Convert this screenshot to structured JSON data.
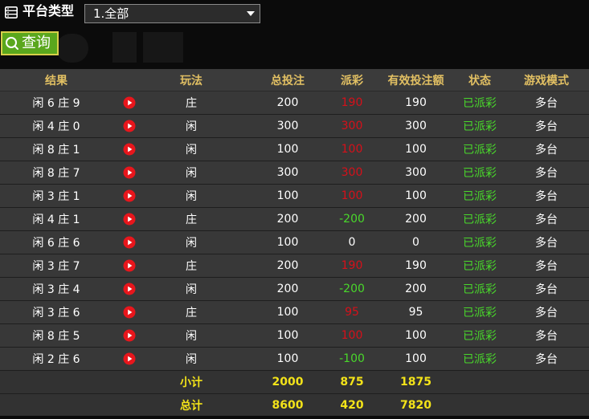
{
  "header": {
    "platform_label": "平台类型",
    "select_value": "1.全部",
    "query_label": "查询"
  },
  "table": {
    "columns": [
      "结果",
      "玩法",
      "总投注",
      "派彩",
      "有效投注额",
      "状态",
      "游戏模式"
    ],
    "rows": [
      {
        "result": "闲 6 庄 9",
        "method": "庄",
        "bet": "200",
        "payout": "190",
        "payout_color": "#d6101a",
        "valid": "190",
        "status": "已派彩",
        "mode": "多台"
      },
      {
        "result": "闲 4 庄 0",
        "method": "闲",
        "bet": "300",
        "payout": "300",
        "payout_color": "#d6101a",
        "valid": "300",
        "status": "已派彩",
        "mode": "多台"
      },
      {
        "result": "闲 8 庄 1",
        "method": "闲",
        "bet": "100",
        "payout": "100",
        "payout_color": "#d6101a",
        "valid": "100",
        "status": "已派彩",
        "mode": "多台"
      },
      {
        "result": "闲 8 庄 7",
        "method": "闲",
        "bet": "300",
        "payout": "300",
        "payout_color": "#d6101a",
        "valid": "300",
        "status": "已派彩",
        "mode": "多台"
      },
      {
        "result": "闲 3 庄 1",
        "method": "闲",
        "bet": "100",
        "payout": "100",
        "payout_color": "#d6101a",
        "valid": "100",
        "status": "已派彩",
        "mode": "多台"
      },
      {
        "result": "闲 4 庄 1",
        "method": "庄",
        "bet": "200",
        "payout": "-200",
        "payout_color": "#49d82b",
        "valid": "200",
        "status": "已派彩",
        "mode": "多台"
      },
      {
        "result": "闲 6 庄 6",
        "method": "闲",
        "bet": "100",
        "payout": "0",
        "payout_color": "#ffffff",
        "valid": "0",
        "status": "已派彩",
        "mode": "多台"
      },
      {
        "result": "闲 3 庄 7",
        "method": "庄",
        "bet": "200",
        "payout": "190",
        "payout_color": "#d6101a",
        "valid": "190",
        "status": "已派彩",
        "mode": "多台"
      },
      {
        "result": "闲 3 庄 4",
        "method": "闲",
        "bet": "200",
        "payout": "-200",
        "payout_color": "#49d82b",
        "valid": "200",
        "status": "已派彩",
        "mode": "多台"
      },
      {
        "result": "闲 3 庄 6",
        "method": "庄",
        "bet": "100",
        "payout": "95",
        "payout_color": "#d6101a",
        "valid": "95",
        "status": "已派彩",
        "mode": "多台"
      },
      {
        "result": "闲 8 庄 5",
        "method": "闲",
        "bet": "100",
        "payout": "100",
        "payout_color": "#d6101a",
        "valid": "100",
        "status": "已派彩",
        "mode": "多台"
      },
      {
        "result": "闲 2 庄 6",
        "method": "闲",
        "bet": "100",
        "payout": "-100",
        "payout_color": "#49d82b",
        "valid": "100",
        "status": "已派彩",
        "mode": "多台"
      }
    ],
    "subtotal": {
      "label": "小计",
      "bet": "2000",
      "payout": "875",
      "valid": "1875"
    },
    "total": {
      "label": "总计",
      "bet": "8600",
      "payout": "420",
      "valid": "7820"
    }
  },
  "colors": {
    "header_text": "#e2c063",
    "win_red": "#d6101a",
    "loss_green": "#49d82b",
    "status_green": "#49d82b",
    "summary_yellow": "#f3e319",
    "query_button": "#5aa71d"
  },
  "icons": {
    "list": "list-icon",
    "dropdown": "chevron-down-icon",
    "search": "search-icon",
    "play": "play-icon"
  }
}
